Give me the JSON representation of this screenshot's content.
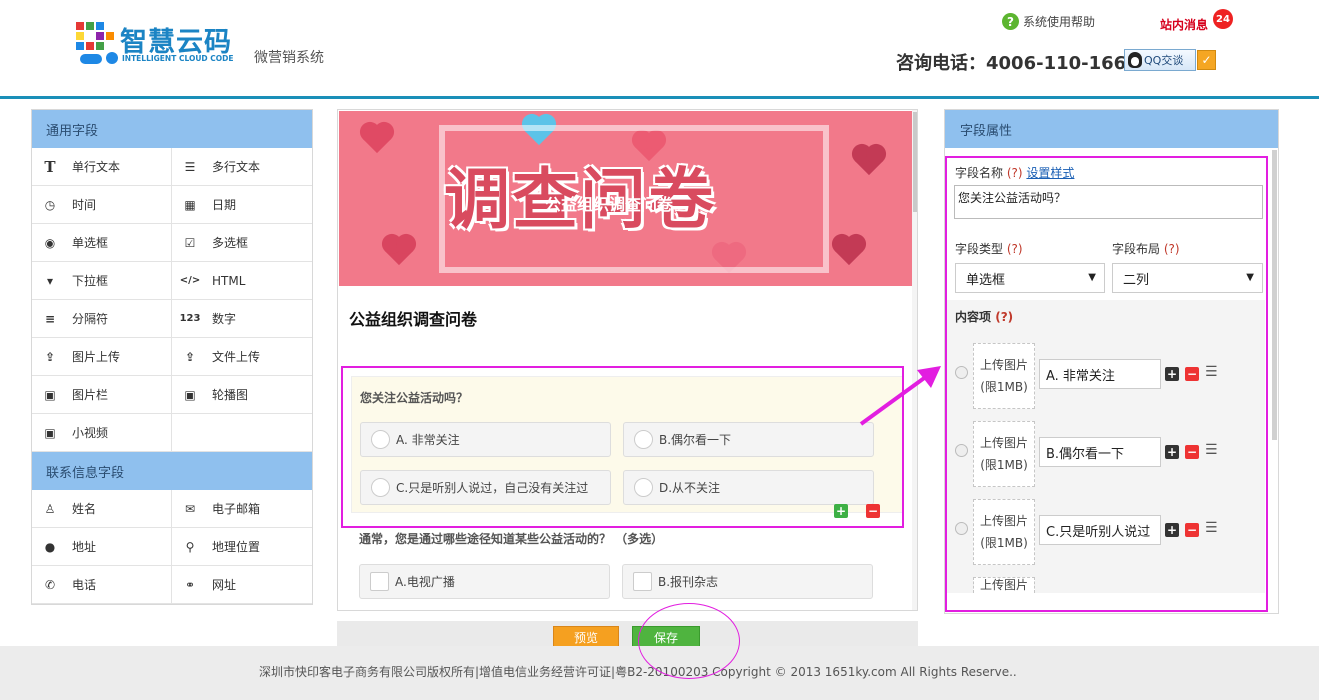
{
  "header": {
    "logo_cn": "智慧云码",
    "logo_en": "INTELLIGENT CLOUD CODE",
    "logo_sub": "微营销系统",
    "help": "系统使用帮助",
    "messages": "站内消息",
    "message_count": "24",
    "phone": "咨询电话：4006-110-166",
    "qq": "QQ交谈"
  },
  "left_panel": {
    "general_title": "通用字段",
    "general_fields": [
      {
        "label": "单行文本",
        "icon": "text-icon"
      },
      {
        "label": "多行文本",
        "icon": "multiline-icon"
      },
      {
        "label": "时间",
        "icon": "clock-icon"
      },
      {
        "label": "日期",
        "icon": "calendar-icon"
      },
      {
        "label": "单选框",
        "icon": "radio-icon"
      },
      {
        "label": "多选框",
        "icon": "checkbox-icon"
      },
      {
        "label": "下拉框",
        "icon": "dropdown-icon"
      },
      {
        "label": "HTML",
        "icon": "code-icon"
      },
      {
        "label": "分隔符",
        "icon": "separator-icon"
      },
      {
        "label": "数字",
        "icon": "number-icon"
      },
      {
        "label": "图片上传",
        "icon": "upload-icon"
      },
      {
        "label": "文件上传",
        "icon": "upload-icon"
      },
      {
        "label": "图片栏",
        "icon": "image-icon"
      },
      {
        "label": "轮播图",
        "icon": "image-icon"
      },
      {
        "label": "小视频",
        "icon": "image-icon"
      }
    ],
    "contact_title": "联系信息字段",
    "contact_fields": [
      {
        "label": "姓名",
        "icon": "user-icon"
      },
      {
        "label": "电子邮箱",
        "icon": "email-icon"
      },
      {
        "label": "地址",
        "icon": "globe-icon"
      },
      {
        "label": "地理位置",
        "icon": "location-icon"
      },
      {
        "label": "电话",
        "icon": "phone-icon"
      },
      {
        "label": "网址",
        "icon": "link-icon"
      }
    ]
  },
  "center": {
    "banner_big": "调查问卷",
    "banner_small": "公益组织调查问卷",
    "form_title": "公益组织调查问卷",
    "q1": {
      "label": "您关注公益活动吗？",
      "options": [
        "A. 非常关注",
        "B.偶尔看一下",
        "C.只是听别人说过，自己没有关注过",
        "D.从不关注"
      ]
    },
    "q2": {
      "label": "通常，您是通过哪些途径知道某些公益活动的？ （多选）",
      "options": [
        "A.电视广播",
        "B.报刊杂志"
      ]
    },
    "preview_button": "预览",
    "save_button": "保存"
  },
  "right_panel": {
    "title": "字段属性",
    "field_name_label": "字段名称",
    "q_mark": "(?)",
    "set_style": "设置样式",
    "field_name_value": "您关注公益活动吗？",
    "field_type_label": "字段类型",
    "field_type_value": "单选框",
    "field_layout_label": "字段布局",
    "field_layout_value": "二列",
    "content_label": "内容项",
    "upload_line1": "上传图片",
    "upload_line2": "(限1MB)",
    "items": [
      "A. 非常关注",
      "B.偶尔看一下",
      "C.只是听别人说过"
    ]
  },
  "footer": {
    "text": "深圳市快印客电子商务有限公司版权所有|增值电信业务经营许可证|粤B2-20100203 Copyright © 2013 1651ky.com All Rights Reserve.."
  },
  "colors": {
    "accent_blue": "#8fc0ee",
    "highlight": "#e21ee0",
    "header_line": "#1a8fb8",
    "save_green": "#4fb43f",
    "preview_orange": "#f5a020"
  }
}
